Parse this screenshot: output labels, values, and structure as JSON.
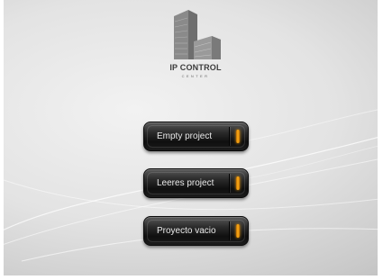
{
  "logo": {
    "icon": "building-icon",
    "title": "IP CONTROL",
    "subtitle": "CENTER"
  },
  "buttons": [
    {
      "label": "Empty project",
      "indicator": "orange"
    },
    {
      "label": "Leeres project",
      "indicator": "orange"
    },
    {
      "label": "Proyecto vacio",
      "indicator": "orange"
    }
  ],
  "colors": {
    "button_bg": "#1a1a1a",
    "button_text": "#e8e8e8",
    "indicator": "#ffa500",
    "background": "#e0e0e0"
  }
}
